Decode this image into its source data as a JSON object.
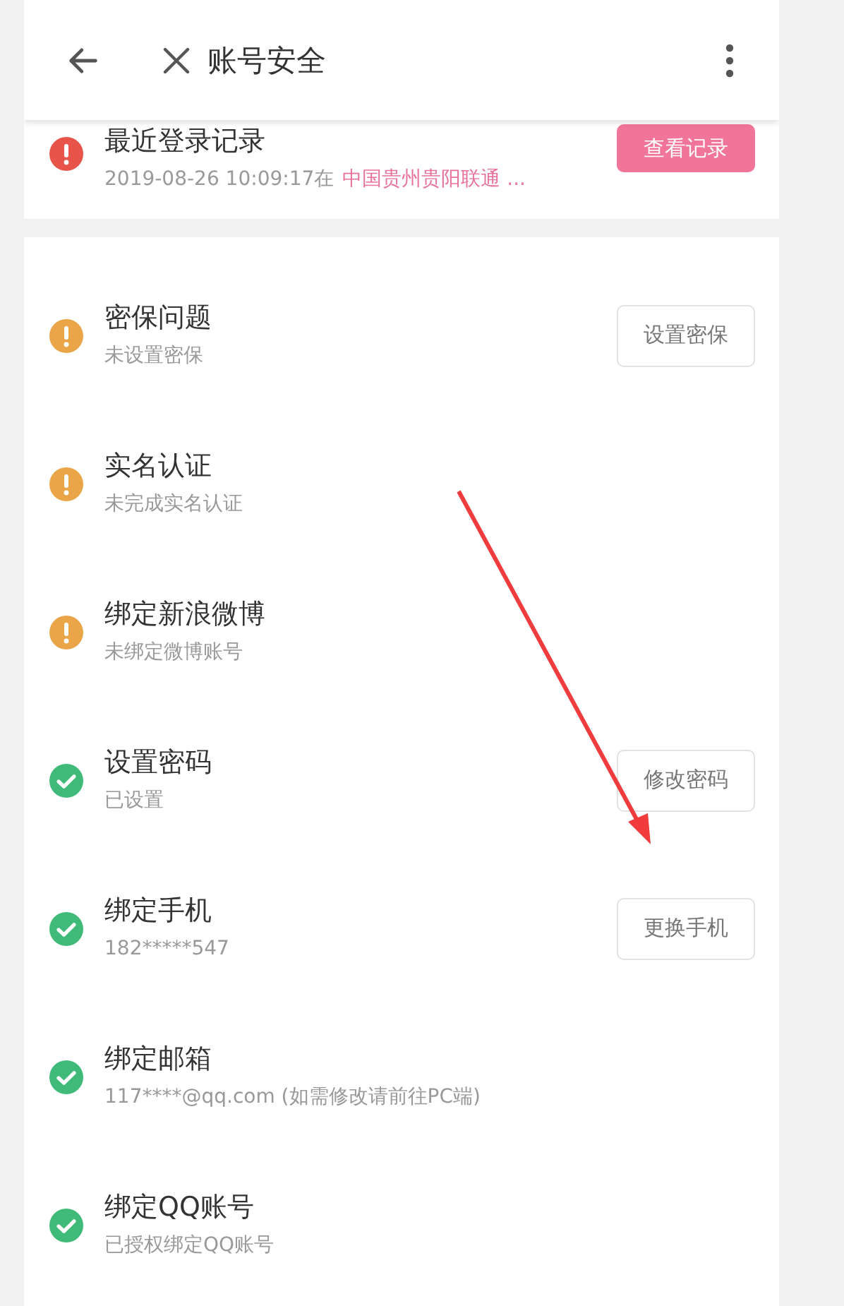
{
  "header": {
    "title": "账号安全"
  },
  "login_record": {
    "kind": "error",
    "title": "最近登录记录",
    "subtitle": "2019-08-26 10:09:17在",
    "location": "中国贵州贵阳联通 ...",
    "button": {
      "label": "查看记录",
      "kind": "filled"
    }
  },
  "items": [
    {
      "kind": "warning",
      "title": "密保问题",
      "subtitle": "未设置密保",
      "button": {
        "label": "设置密保",
        "kind": "outlined"
      }
    },
    {
      "kind": "warning",
      "title": "实名认证",
      "subtitle": "未完成实名认证"
    },
    {
      "kind": "warning",
      "title": "绑定新浪微博",
      "subtitle": "未绑定微博账号"
    },
    {
      "kind": "ok",
      "title": "设置密码",
      "subtitle": "已设置",
      "button": {
        "label": "修改密码",
        "kind": "outlined"
      }
    },
    {
      "kind": "ok",
      "title": "绑定手机",
      "subtitle": "182*****547",
      "button": {
        "label": "更换手机",
        "kind": "outlined"
      }
    },
    {
      "kind": "ok",
      "title": "绑定邮箱",
      "subtitle": "117****@qq.com (如需修改请前往PC端)"
    },
    {
      "kind": "ok",
      "title": "绑定QQ账号",
      "subtitle": "已授权绑定QQ账号"
    }
  ]
}
